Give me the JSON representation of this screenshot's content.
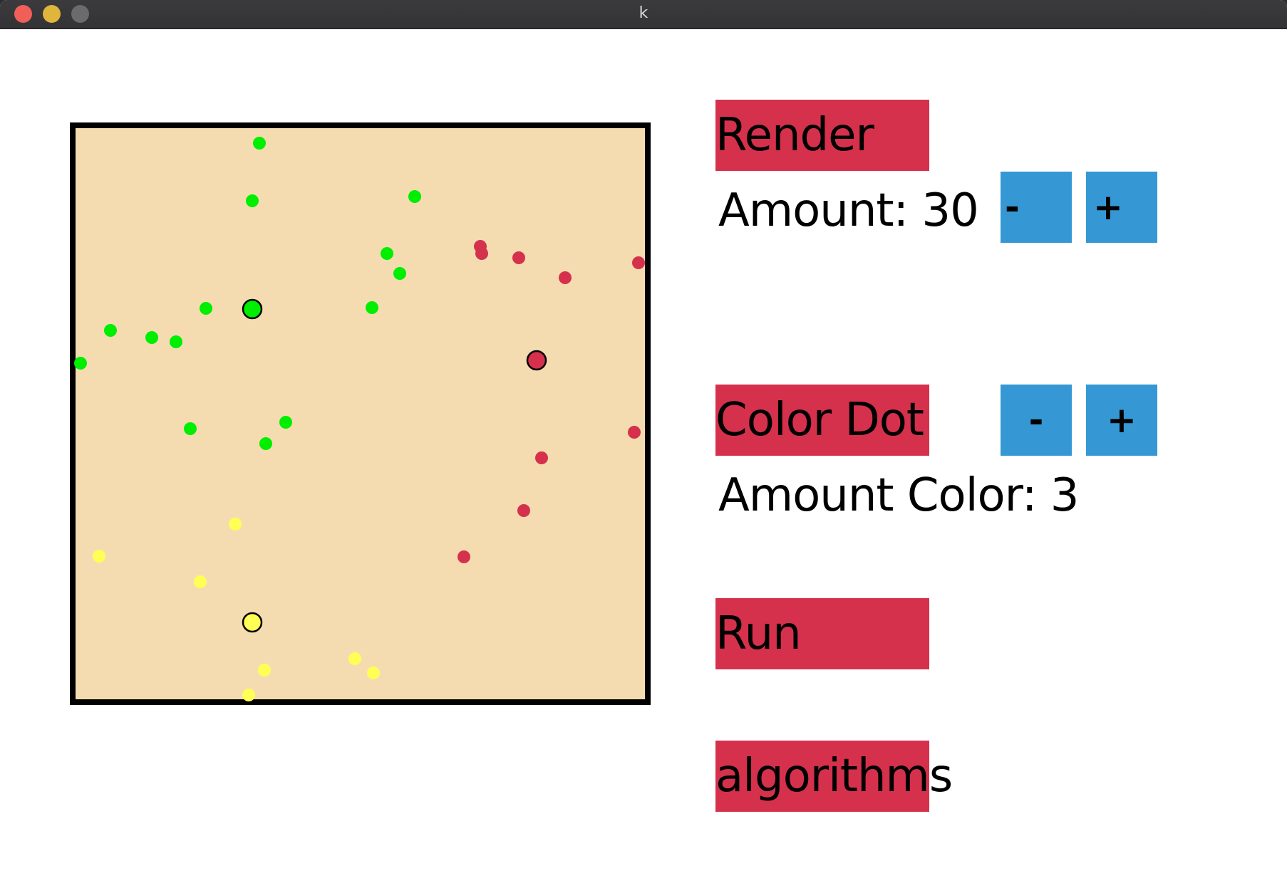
{
  "window": {
    "title": "k"
  },
  "colors": {
    "canvas_fill": "#f5dcb0",
    "canvas_border": "#000000",
    "button_red": "#d5314c",
    "button_blue": "#3598d5",
    "green": "#00ee00",
    "red": "#d5314c",
    "yellow": "#ffff55"
  },
  "render_section": {
    "button_label": "Render",
    "amount_label": "Amount: 30",
    "minus_label": "-",
    "plus_label": "+"
  },
  "color_section": {
    "button_label": "Color Dot",
    "minus_label": "-",
    "plus_label": "+",
    "amount_label": "Amount Color: 3"
  },
  "run_button_label": "Run",
  "algorithms_button_label": "algorithms"
}
